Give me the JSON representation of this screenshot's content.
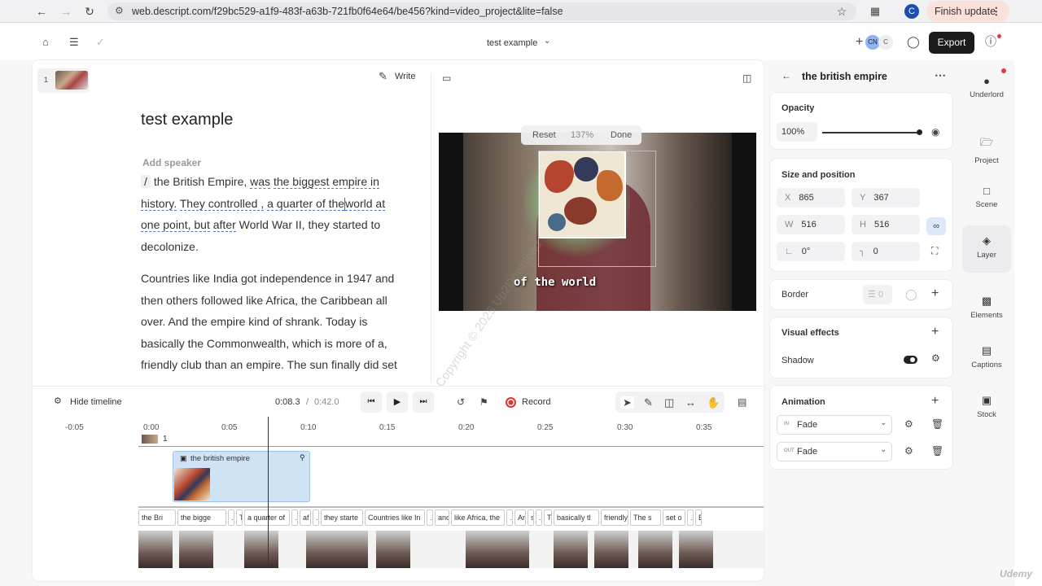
{
  "browser": {
    "url": "web.descript.com/f29bc529-a1f9-483f-a63b-721fb0f64e64/be456?kind=video_project&lite=false",
    "profile_initial": "C",
    "finish_update": "Finish update"
  },
  "appbar": {
    "project_title": "test example",
    "collab_initials": [
      "CN",
      "C"
    ],
    "export_label": "Export"
  },
  "script": {
    "scene_number": "1",
    "write_label": "Write",
    "title": "test example",
    "add_speaker": "Add speaker",
    "marker": "/",
    "para1": {
      "a": "the British Empire,",
      "b": "was",
      "c": "the biggest empire in history.",
      "d": "They controlled ,",
      "e": "a quarter of the",
      "f": "world at one point, but",
      "g": "after",
      "h": "World War II,",
      "i": "they started to decolonize."
    },
    "para2": "Countries like India got independence in 1947 and then others followed like Africa, the Caribbean all over. And the empire kind of shrank. Today is basically the Commonwealth, which is more of a, friendly club than an empire. The sun finally did set on the British Empire."
  },
  "preview": {
    "reset": "Reset",
    "zoom": "137%",
    "done": "Done",
    "caption": "of the world",
    "watermark": "Copyright © 2025 Up2Download"
  },
  "timeline": {
    "hide_label": "Hide timeline",
    "current_time": "0:08.3",
    "separator": "/",
    "total_time": "0:42.0",
    "record_label": "Record",
    "ticks": [
      "-0:05",
      "0:00",
      "0:05",
      "0:10",
      "0:15",
      "0:20",
      "0:25",
      "0:30",
      "0:35"
    ],
    "scene_label": "1",
    "layer_clip": "the british empire",
    "word_segments": [
      "the Bri",
      "the bigge",
      "...",
      "T",
      "a quarter of",
      "...",
      "af",
      "...",
      "they starte",
      "Countries like In",
      "...",
      "and",
      "like Africa, the",
      "...",
      "An",
      "s",
      "...",
      "To",
      "basically tl",
      "friendly",
      "The s",
      "set o",
      "...",
      "E"
    ]
  },
  "panel": {
    "title": "the british empire",
    "opacity": {
      "title": "Opacity",
      "value": "100%",
      "level": 1.0
    },
    "size_position": {
      "title": "Size and position",
      "x_label": "X",
      "x": "865",
      "y_label": "Y",
      "y": "367",
      "w_label": "W",
      "w": "516",
      "h_label": "H",
      "h": "516",
      "rotation": "0°",
      "corner": "0"
    },
    "border": {
      "title": "Border",
      "value": "0"
    },
    "visual_effects": {
      "title": "Visual effects",
      "shadow": "Shadow"
    },
    "animation": {
      "title": "Animation",
      "in_tag": "IN",
      "in_value": "Fade",
      "out_tag": "OUT",
      "out_value": "Fade"
    }
  },
  "rail": [
    "Underlord",
    "Project",
    "Scene",
    "Layer",
    "Elements",
    "Captions",
    "Stock"
  ],
  "footer_logo": "Udemy"
}
